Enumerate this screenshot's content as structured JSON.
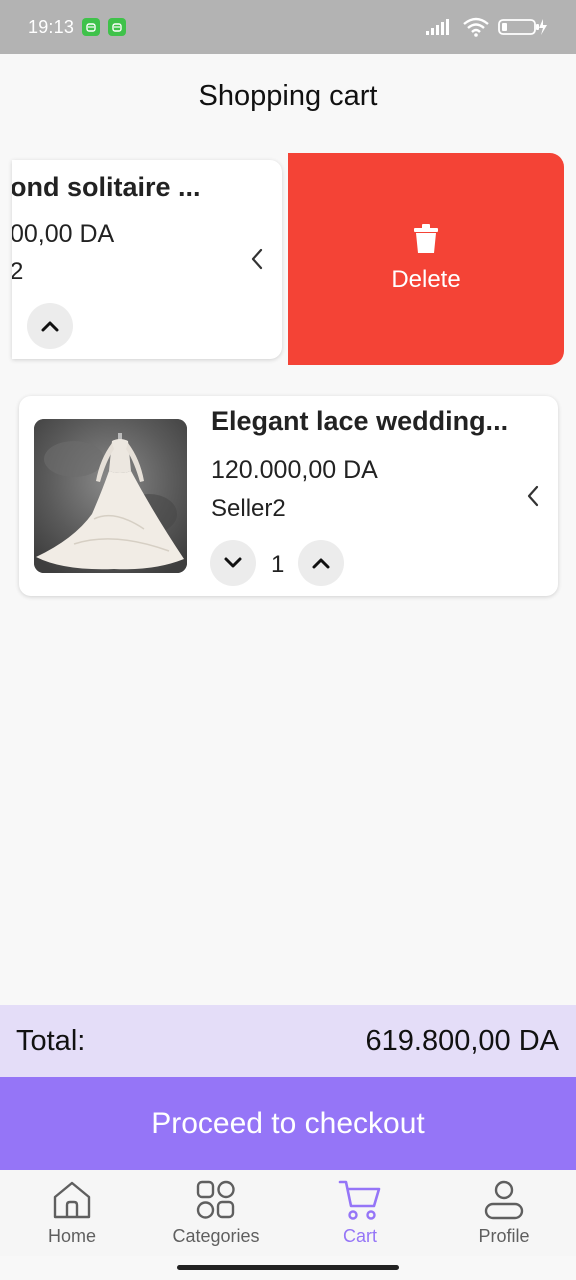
{
  "status_bar": {
    "time": "19:13"
  },
  "page_title": "Shopping cart",
  "cart_items": [
    {
      "title": "ond solitaire ...",
      "price": "00,00 DA",
      "seller": "2"
    },
    {
      "title": "Elegant lace wedding...",
      "price": "120.000,00 DA",
      "seller": "Seller2",
      "quantity": "1"
    }
  ],
  "delete_action": {
    "label": "Delete",
    "color": "#f44336"
  },
  "total": {
    "label": "Total:",
    "value": "619.800,00 DA"
  },
  "checkout": {
    "label": "Proceed to checkout",
    "color": "#9575f7"
  },
  "nav": {
    "items": [
      {
        "label": "Home",
        "icon": "home-icon"
      },
      {
        "label": "Categories",
        "icon": "categories-icon"
      },
      {
        "label": "Cart",
        "icon": "cart-icon",
        "active": true
      },
      {
        "label": "Profile",
        "icon": "profile-icon"
      }
    ]
  }
}
